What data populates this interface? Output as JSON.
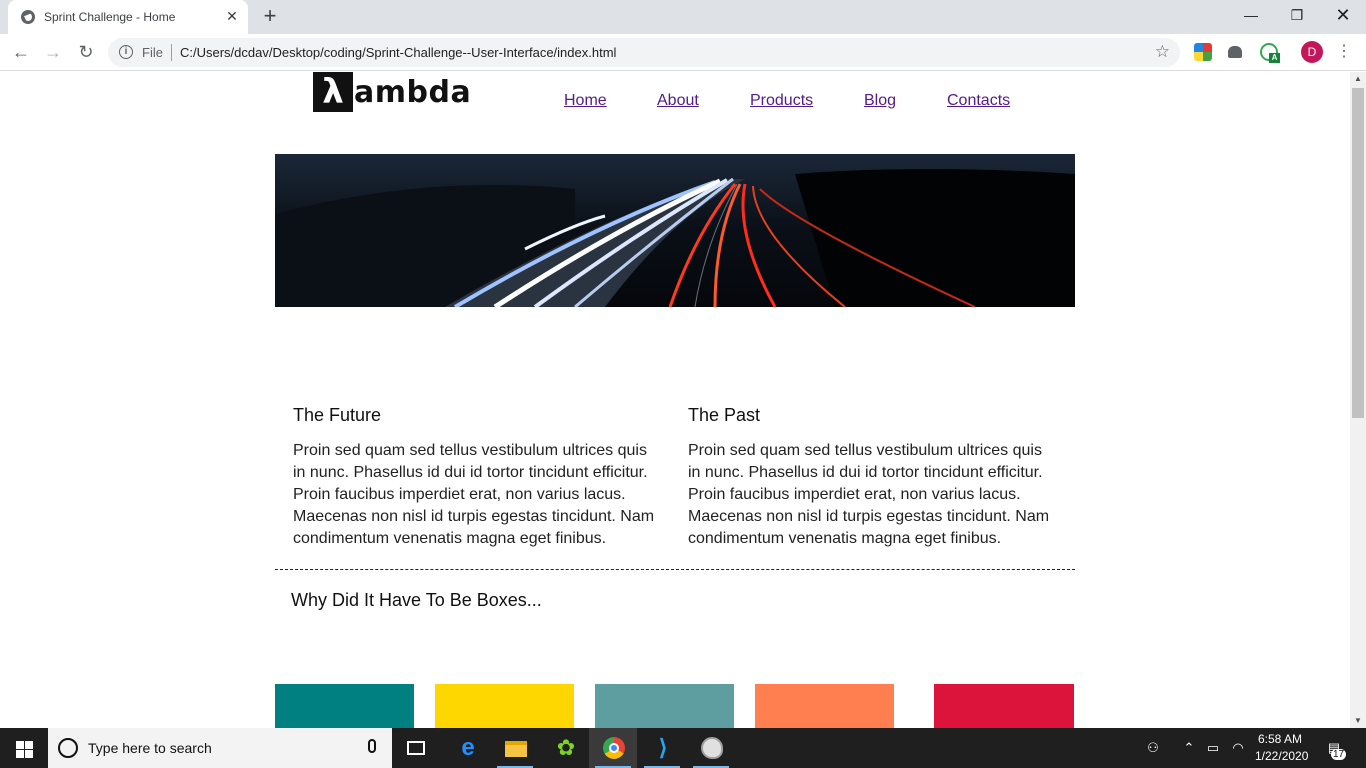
{
  "browser": {
    "tab_title": "Sprint Challenge - Home",
    "tab_close": "✕",
    "new_tab": "+",
    "window_controls": {
      "minimize": "—",
      "maximize": "❐",
      "close": "✕"
    },
    "scheme_label": "File",
    "url": "C:/Users/dcdav/Desktop/coding/Sprint-Challenge--User-Interface/index.html",
    "profile_initial": "D",
    "extension_badge": "A"
  },
  "page": {
    "logo": {
      "mark": "λ",
      "text": "ambda"
    },
    "nav": [
      "Home",
      "About",
      "Products",
      "Blog",
      "Contacts"
    ],
    "columns": [
      {
        "heading": "The Future",
        "body": "Proin sed quam sed tellus vestibulum ultrices quis in nunc. Phasellus id dui id tortor tincidunt efficitur. Proin faucibus imperdiet erat, non varius lacus. Maecenas non nisl id turpis egestas tincidunt. Nam condimentum venenatis magna eget finibus."
      },
      {
        "heading": "The Past",
        "body": "Proin sed quam sed tellus vestibulum ultrices quis in nunc. Phasellus id dui id tortor tincidunt efficitur. Proin faucibus imperdiet erat, non varius lacus. Maecenas non nisl id turpis egestas tincidunt. Nam condimentum venenatis magna eget finibus."
      }
    ],
    "boxes_title": "Why Did It Have To Be Boxes...",
    "box_colors": [
      "#008080",
      "#ffd700",
      "#5f9ea0",
      "#ff7f50",
      "#dc143c"
    ]
  },
  "taskbar": {
    "search_placeholder": "Type here to search",
    "time": "6:58 AM",
    "date": "1/22/2020",
    "notification_count": "17"
  }
}
